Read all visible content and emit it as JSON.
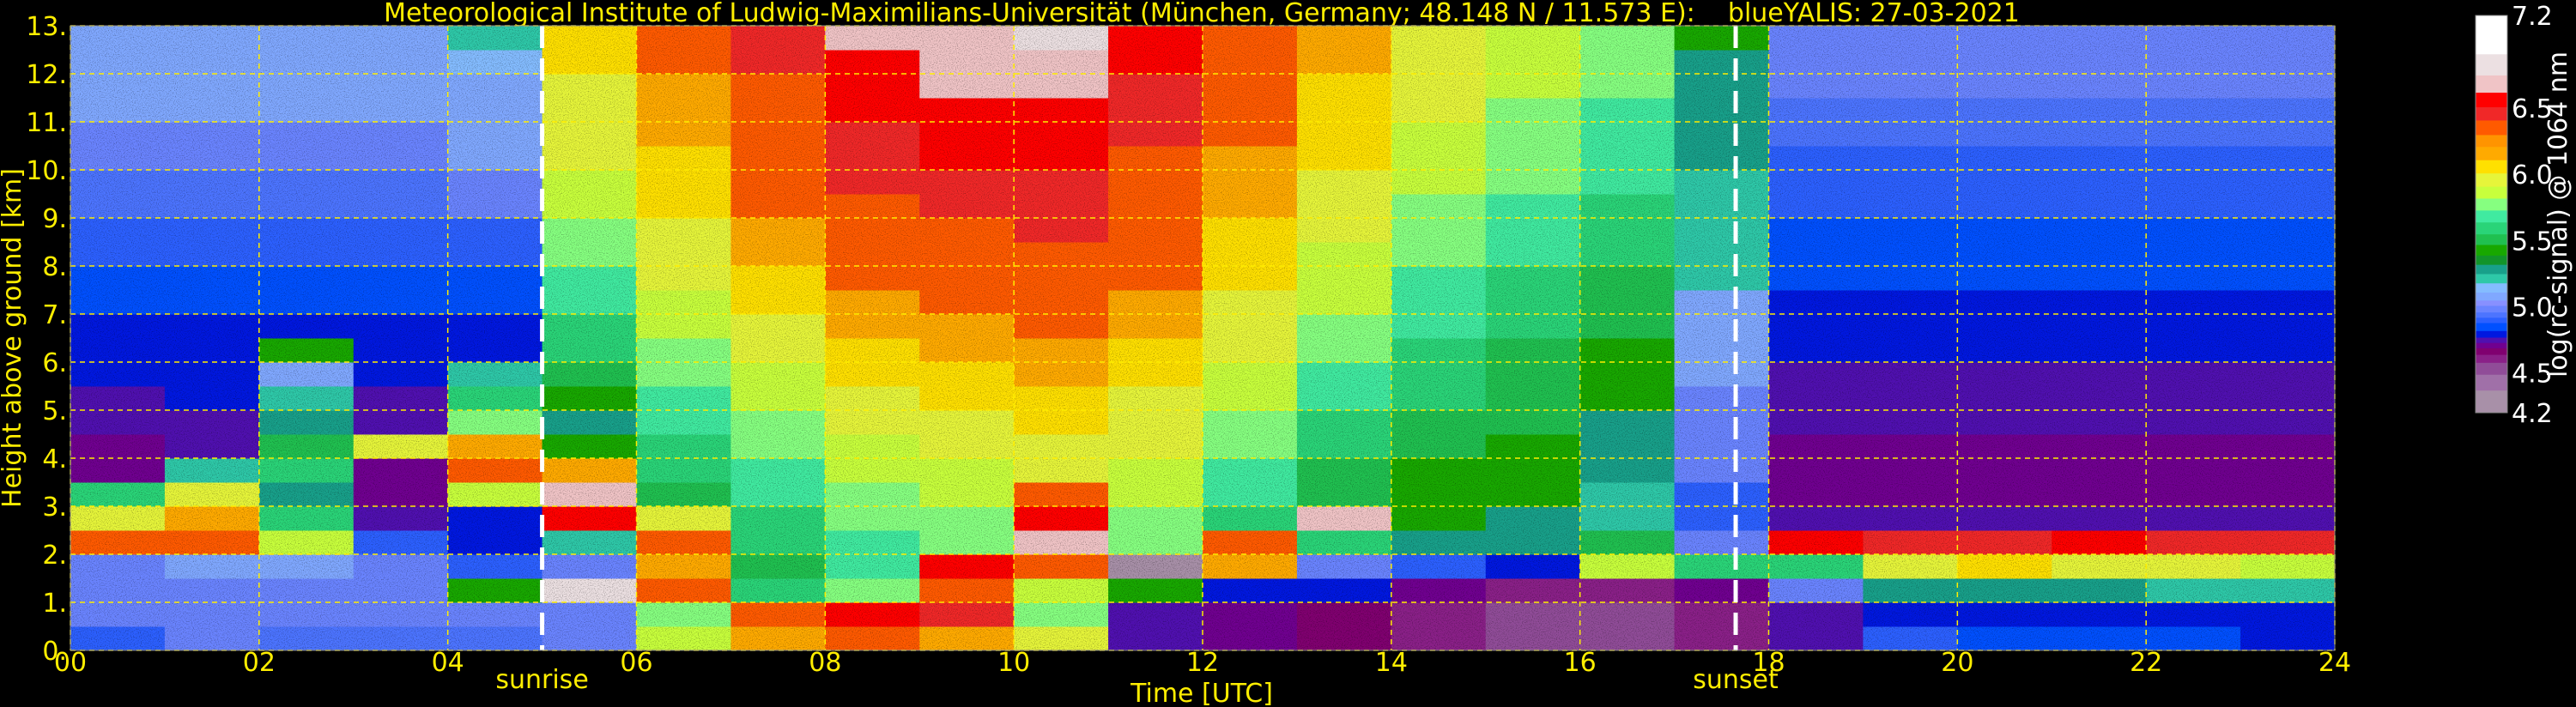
{
  "chart_data": {
    "type": "heatmap",
    "title": "Meteorological Institute of Ludwig-Maximilians-Universität (München, Germany; 48.148 N / 11.573 E):    blueYALIS: 27-03-2021",
    "xlabel": "Time [UTC]",
    "ylabel": "Height above ground [km]",
    "xlim": [
      0,
      24
    ],
    "ylim": [
      0,
      13
    ],
    "x_ticks": [
      0,
      2,
      4,
      6,
      8,
      10,
      12,
      14,
      16,
      18,
      20,
      22,
      24
    ],
    "x_ticklabels": [
      "00",
      "02",
      "04",
      "06",
      "08",
      "10",
      "12",
      "14",
      "16",
      "18",
      "20",
      "22",
      "24"
    ],
    "y_ticks": [
      0,
      1,
      2,
      3,
      4,
      5,
      6,
      7,
      8,
      9,
      10,
      11,
      12,
      13
    ],
    "y_ticklabels": [
      "0.",
      "1.",
      "2.",
      "3.",
      "4.",
      "5.",
      "6.",
      "7.",
      "8.",
      "9.",
      "10.",
      "11.",
      "12.",
      "13."
    ],
    "grid": true,
    "annotations": [
      {
        "label": "sunrise",
        "time": 5.0
      },
      {
        "label": "sunset",
        "time": 17.65
      }
    ],
    "time_bin_hours": 1,
    "height_bin_km": 0.5,
    "z": [
      [
        4.9,
        5.0,
        5.0,
        5.0,
        6.3,
        6.0,
        5.6,
        4.7,
        4.7,
        4.75,
        4.75,
        4.8,
        4.8,
        4.8,
        4.85,
        4.85,
        4.9,
        4.9,
        4.95,
        4.95,
        5.0,
        5.0,
        5.05,
        5.05,
        5.1,
        5.1
      ],
      [
        5.0,
        5.0,
        5.0,
        5.1,
        6.4,
        6.2,
        6.0,
        5.2,
        4.75,
        4.75,
        4.8,
        4.8,
        4.8,
        4.8,
        4.85,
        4.85,
        4.9,
        4.9,
        4.95,
        4.95,
        5.0,
        5.0,
        5.05,
        5.05,
        5.1,
        5.1
      ],
      [
        4.95,
        5.0,
        5.0,
        5.05,
        5.9,
        5.6,
        5.3,
        5.6,
        5.5,
        5.3,
        5.2,
        5.1,
        5.4,
        4.8,
        4.85,
        4.85,
        4.9,
        4.9,
        4.95,
        4.95,
        5.0,
        5.0,
        5.05,
        5.05,
        5.1,
        5.1
      ],
      [
        4.95,
        5.0,
        5.0,
        5.0,
        4.9,
        4.75,
        4.7,
        4.7,
        6.0,
        4.75,
        4.75,
        4.8,
        4.8,
        4.8,
        4.85,
        4.85,
        4.9,
        4.9,
        4.95,
        4.95,
        5.0,
        5.0,
        5.05,
        5.05,
        5.1,
        5.1
      ],
      [
        4.95,
        5.0,
        5.4,
        4.9,
        4.8,
        4.8,
        5.9,
        6.3,
        6.2,
        5.8,
        5.6,
        5.2,
        4.8,
        4.8,
        4.85,
        4.85,
        4.9,
        4.9,
        5.0,
        5.0,
        5.05,
        5.1,
        5.1,
        5.1,
        5.15,
        5.2
      ],
      [
        5.0,
        5.0,
        6.8,
        5.0,
        5.2,
        6.6,
        6.7,
        6.2,
        5.4,
        5.3,
        5.4,
        5.5,
        5.6,
        5.6,
        5.7,
        5.7,
        5.8,
        5.8,
        5.9,
        5.9,
        6.0,
        6.0,
        6.0,
        6.0,
        6.1,
        6.1
      ],
      [
        5.9,
        5.8,
        6.3,
        6.2,
        6.4,
        6.0,
        5.5,
        5.6,
        5.6,
        5.7,
        5.7,
        5.8,
        5.8,
        5.9,
        5.9,
        6.0,
        6.0,
        6.0,
        6.1,
        6.1,
        6.1,
        6.2,
        6.2,
        6.2,
        6.3,
        6.3
      ],
      [
        6.2,
        6.4,
        5.6,
        5.5,
        5.6,
        5.6,
        5.7,
        5.7,
        5.8,
        5.8,
        5.9,
        5.9,
        6.0,
        6.0,
        6.1,
        6.1,
        6.2,
        6.2,
        6.3,
        6.3,
        6.3,
        6.4,
        6.4,
        6.4,
        6.5,
        6.5
      ],
      [
        6.4,
        6.6,
        5.8,
        5.7,
        5.7,
        5.8,
        5.8,
        5.9,
        5.9,
        6.0,
        6.0,
        6.1,
        6.1,
        6.2,
        6.2,
        6.3,
        6.3,
        6.4,
        6.4,
        6.5,
        6.5,
        6.5,
        6.6,
        6.6,
        6.6,
        6.7
      ],
      [
        6.2,
        6.5,
        6.4,
        6.6,
        5.8,
        5.8,
        5.9,
        5.9,
        6.0,
        6.0,
        6.1,
        6.1,
        6.2,
        6.2,
        6.3,
        6.3,
        6.4,
        6.4,
        6.5,
        6.5,
        6.6,
        6.6,
        6.6,
        6.7,
        6.7,
        6.7
      ],
      [
        6.0,
        5.8,
        5.9,
        6.3,
        6.7,
        6.6,
        6.4,
        6.0,
        6.0,
        6.1,
        6.1,
        6.2,
        6.2,
        6.3,
        6.3,
        6.4,
        6.4,
        6.5,
        6.5,
        6.5,
        6.6,
        6.6,
        6.6,
        6.7,
        6.7,
        6.8
      ],
      [
        4.75,
        4.75,
        5.4,
        4.2,
        5.8,
        5.8,
        5.9,
        5.9,
        6.0,
        6.0,
        6.0,
        6.1,
        6.1,
        6.2,
        6.2,
        6.3,
        6.3,
        6.3,
        6.4,
        6.4,
        6.4,
        6.5,
        6.5,
        6.5,
        6.6,
        6.6
      ],
      [
        4.7,
        4.7,
        4.8,
        6.2,
        6.4,
        5.6,
        5.7,
        5.7,
        5.8,
        5.8,
        5.9,
        5.9,
        6.0,
        6.0,
        6.0,
        6.1,
        6.1,
        6.1,
        6.2,
        6.2,
        6.2,
        6.3,
        6.3,
        6.3,
        6.3,
        6.4
      ],
      [
        4.65,
        4.65,
        4.8,
        5.0,
        5.6,
        6.7,
        5.5,
        5.5,
        5.6,
        5.6,
        5.7,
        5.7,
        5.8,
        5.8,
        5.9,
        5.9,
        5.9,
        6.0,
        6.0,
        6.0,
        6.1,
        6.1,
        6.1,
        6.1,
        6.2,
        6.2
      ],
      [
        4.6,
        4.6,
        4.7,
        4.9,
        5.3,
        5.4,
        5.4,
        5.4,
        5.5,
        5.5,
        5.6,
        5.6,
        5.6,
        5.7,
        5.7,
        5.7,
        5.8,
        5.8,
        5.8,
        5.9,
        5.9,
        5.9,
        6.0,
        6.0,
        6.0,
        6.0
      ],
      [
        4.55,
        4.55,
        4.6,
        4.8,
        5.3,
        5.3,
        5.4,
        5.4,
        5.4,
        5.5,
        5.5,
        5.5,
        5.5,
        5.6,
        5.6,
        5.6,
        5.7,
        5.7,
        5.7,
        5.8,
        5.8,
        5.8,
        5.8,
        5.9,
        5.9,
        5.9
      ],
      [
        4.55,
        4.55,
        4.6,
        5.9,
        5.5,
        5.2,
        5.2,
        5.3,
        5.3,
        5.3,
        5.4,
        5.4,
        5.4,
        5.5,
        5.5,
        5.5,
        5.6,
        5.6,
        5.6,
        5.7,
        5.7,
        5.7,
        5.7,
        5.8,
        5.8,
        5.8
      ],
      [
        4.6,
        4.6,
        4.7,
        5.6,
        5.0,
        4.9,
        4.9,
        5.0,
        5.0,
        5.0,
        5.0,
        5.1,
        5.1,
        5.1,
        5.1,
        5.2,
        5.2,
        5.2,
        5.2,
        5.2,
        5.3,
        5.3,
        5.3,
        5.3,
        5.3,
        5.4
      ],
      [
        4.75,
        4.75,
        5.0,
        5.6,
        6.6,
        4.75,
        4.7,
        4.7,
        4.7,
        4.75,
        4.75,
        4.75,
        4.8,
        4.8,
        4.8,
        4.85,
        4.85,
        4.85,
        4.9,
        4.9,
        4.9,
        4.95,
        4.95,
        5.0,
        5.0,
        5.0
      ],
      [
        4.9,
        4.8,
        5.3,
        6.0,
        6.5,
        4.75,
        4.7,
        4.7,
        4.7,
        4.75,
        4.75,
        4.75,
        4.8,
        4.8,
        4.8,
        4.85,
        4.85,
        4.85,
        4.9,
        4.9,
        4.9,
        4.95,
        4.95,
        5.0,
        5.0,
        5.0
      ],
      [
        4.85,
        4.8,
        5.3,
        6.1,
        6.5,
        4.75,
        4.7,
        4.7,
        4.7,
        4.75,
        4.75,
        4.75,
        4.8,
        4.8,
        4.8,
        4.85,
        4.85,
        4.85,
        4.9,
        4.9,
        4.9,
        4.95,
        4.95,
        5.0,
        5.0,
        5.0
      ],
      [
        4.85,
        4.8,
        5.3,
        6.0,
        6.6,
        4.75,
        4.7,
        4.7,
        4.7,
        4.75,
        4.75,
        4.75,
        4.8,
        4.8,
        4.8,
        4.85,
        4.85,
        4.85,
        4.9,
        4.9,
        4.9,
        4.95,
        4.95,
        5.0,
        5.0,
        5.0
      ],
      [
        4.85,
        4.8,
        5.2,
        6.0,
        6.5,
        4.75,
        4.7,
        4.7,
        4.7,
        4.75,
        4.75,
        4.75,
        4.8,
        4.8,
        4.8,
        4.85,
        4.85,
        4.85,
        4.9,
        4.9,
        4.9,
        4.95,
        4.95,
        5.0,
        5.0,
        5.0
      ],
      [
        4.8,
        4.8,
        5.2,
        5.9,
        6.5,
        4.75,
        4.7,
        4.7,
        4.7,
        4.75,
        4.75,
        4.75,
        4.8,
        4.8,
        4.8,
        4.85,
        4.85,
        4.85,
        4.9,
        4.9,
        4.9,
        4.95,
        4.95,
        5.0,
        5.0,
        5.0
      ]
    ],
    "colorbar": {
      "label": "log(rc-signal) @ 1064 nm",
      "range": [
        4.2,
        7.2
      ],
      "ticks": [
        4.2,
        4.5,
        5.0,
        5.5,
        6.0,
        6.5,
        7.2
      ],
      "ticklabels": [
        "4.2",
        "4.5",
        "5.0",
        "5.5",
        "6.0",
        "6.5",
        "7.2"
      ],
      "levels": [
        4.2,
        4.37,
        4.49,
        4.58,
        4.64,
        4.69,
        4.73,
        4.77,
        4.82,
        4.88,
        4.92,
        4.96,
        5.01,
        5.05,
        5.11,
        5.18,
        5.25,
        5.32,
        5.39,
        5.47,
        5.55,
        5.64,
        5.73,
        5.82,
        5.91,
        6.01,
        6.11,
        6.21,
        6.3,
        6.41,
        6.51,
        6.62,
        6.75,
        6.91,
        7.2
      ],
      "colors": [
        "#a890a8",
        "#a070a8",
        "#904c98",
        "#8a2088",
        "#800070",
        "#700090",
        "#5010b0",
        "#0018e0",
        "#0050ff",
        "#2c60ff",
        "#4c74ff",
        "#6a84ff",
        "#8890ff",
        "#80a8ff",
        "#84bcff",
        "#2ec8a8",
        "#18a08a",
        "#12942a",
        "#18a800",
        "#20c050",
        "#2ad478",
        "#40eaa0",
        "#86ff80",
        "#c8ff3c",
        "#e6f53a",
        "#ffe000",
        "#ffaa00",
        "#ff9400",
        "#ff5a00",
        "#f02828",
        "#ff0000",
        "#f0c4c6",
        "#ece0e2",
        "#ffffff"
      ]
    }
  }
}
